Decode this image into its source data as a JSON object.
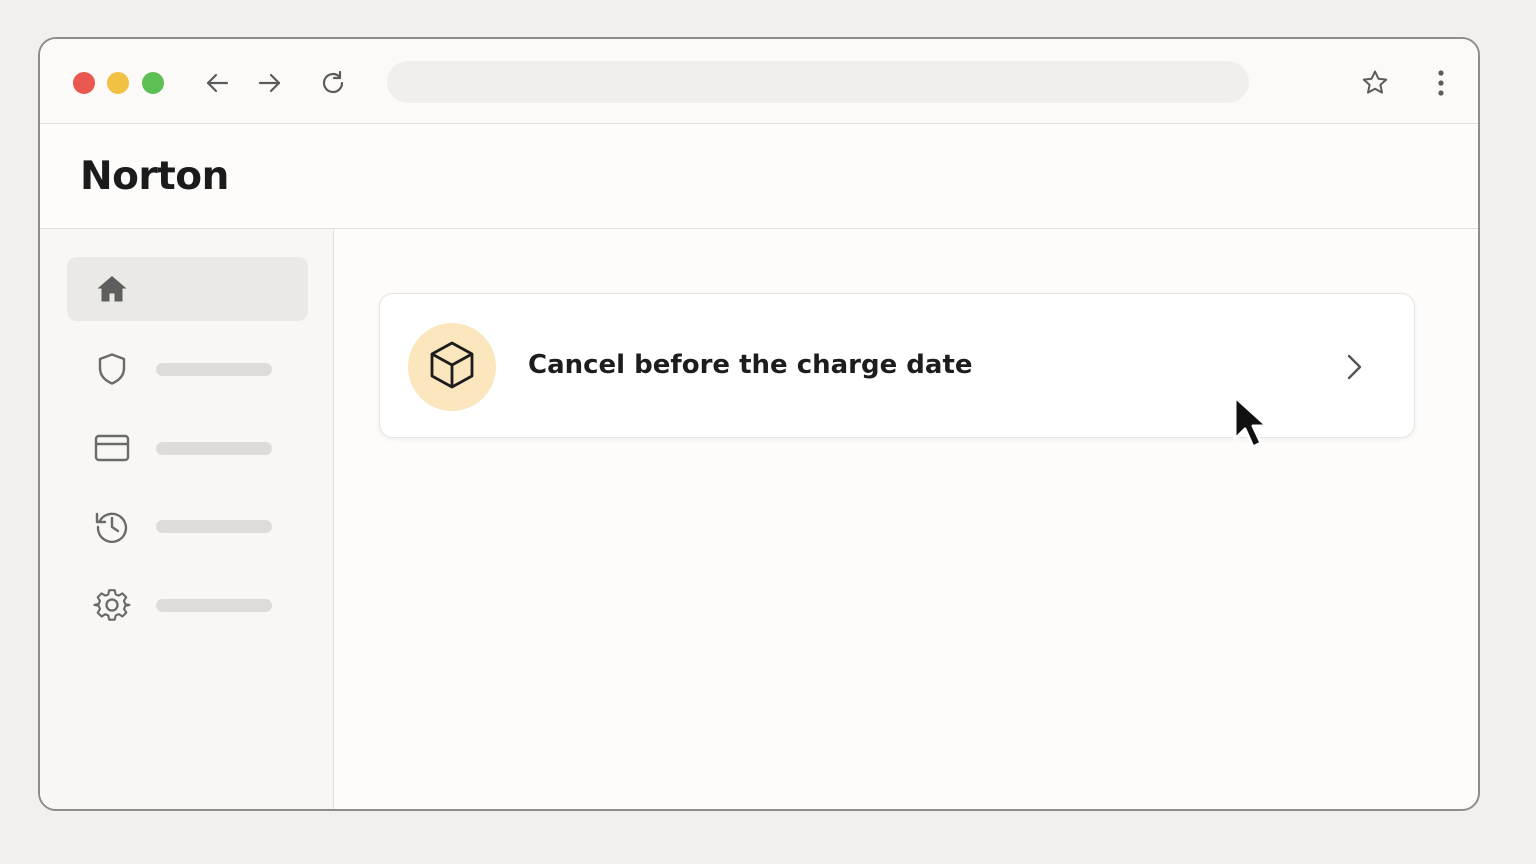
{
  "browser": {
    "url": "",
    "traffic_lights": {
      "close": "#e9584e",
      "minimize": "#f2c043",
      "maximize": "#5cc055"
    },
    "icons": [
      "back-arrow-icon",
      "forward-arrow-icon",
      "reload-icon",
      "star-icon",
      "kebab-menu-icon"
    ]
  },
  "header": {
    "brand": "Norton"
  },
  "sidebar": {
    "items": [
      {
        "icon": "home-icon",
        "active": true
      },
      {
        "icon": "shield-icon",
        "active": false
      },
      {
        "icon": "credit-card-icon",
        "active": false
      },
      {
        "icon": "history-icon",
        "active": false
      },
      {
        "icon": "gear-icon",
        "active": false
      }
    ]
  },
  "main": {
    "card": {
      "icon": "box-icon",
      "title": "Cancel before the charge date",
      "accent": "#fbe6bd"
    }
  }
}
